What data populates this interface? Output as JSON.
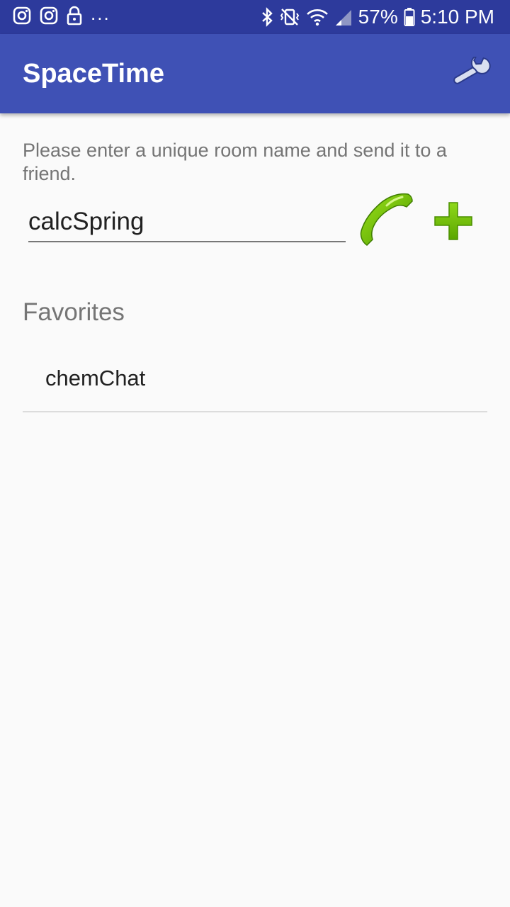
{
  "status_bar": {
    "left_icons": [
      "instagram-icon",
      "instagram-icon",
      "lock-icon"
    ],
    "more_notifications": "...",
    "right_icons": [
      "bluetooth-icon",
      "vibrate-mute-icon",
      "wifi-icon",
      "signal-icon"
    ],
    "battery": "57%",
    "time": "5:10 PM"
  },
  "app_bar": {
    "title": "SpaceTime",
    "settings_icon": "wrench-icon",
    "color": "#3f51b5"
  },
  "main": {
    "instruction": "Please enter a unique room name and send it to a friend.",
    "room_input_value": "calcSpring",
    "call_icon": "phone-icon",
    "add_icon": "plus-icon",
    "accent_color": "#6cbf00"
  },
  "favorites": {
    "title": "Favorites",
    "items": [
      {
        "label": "chemChat"
      }
    ]
  }
}
